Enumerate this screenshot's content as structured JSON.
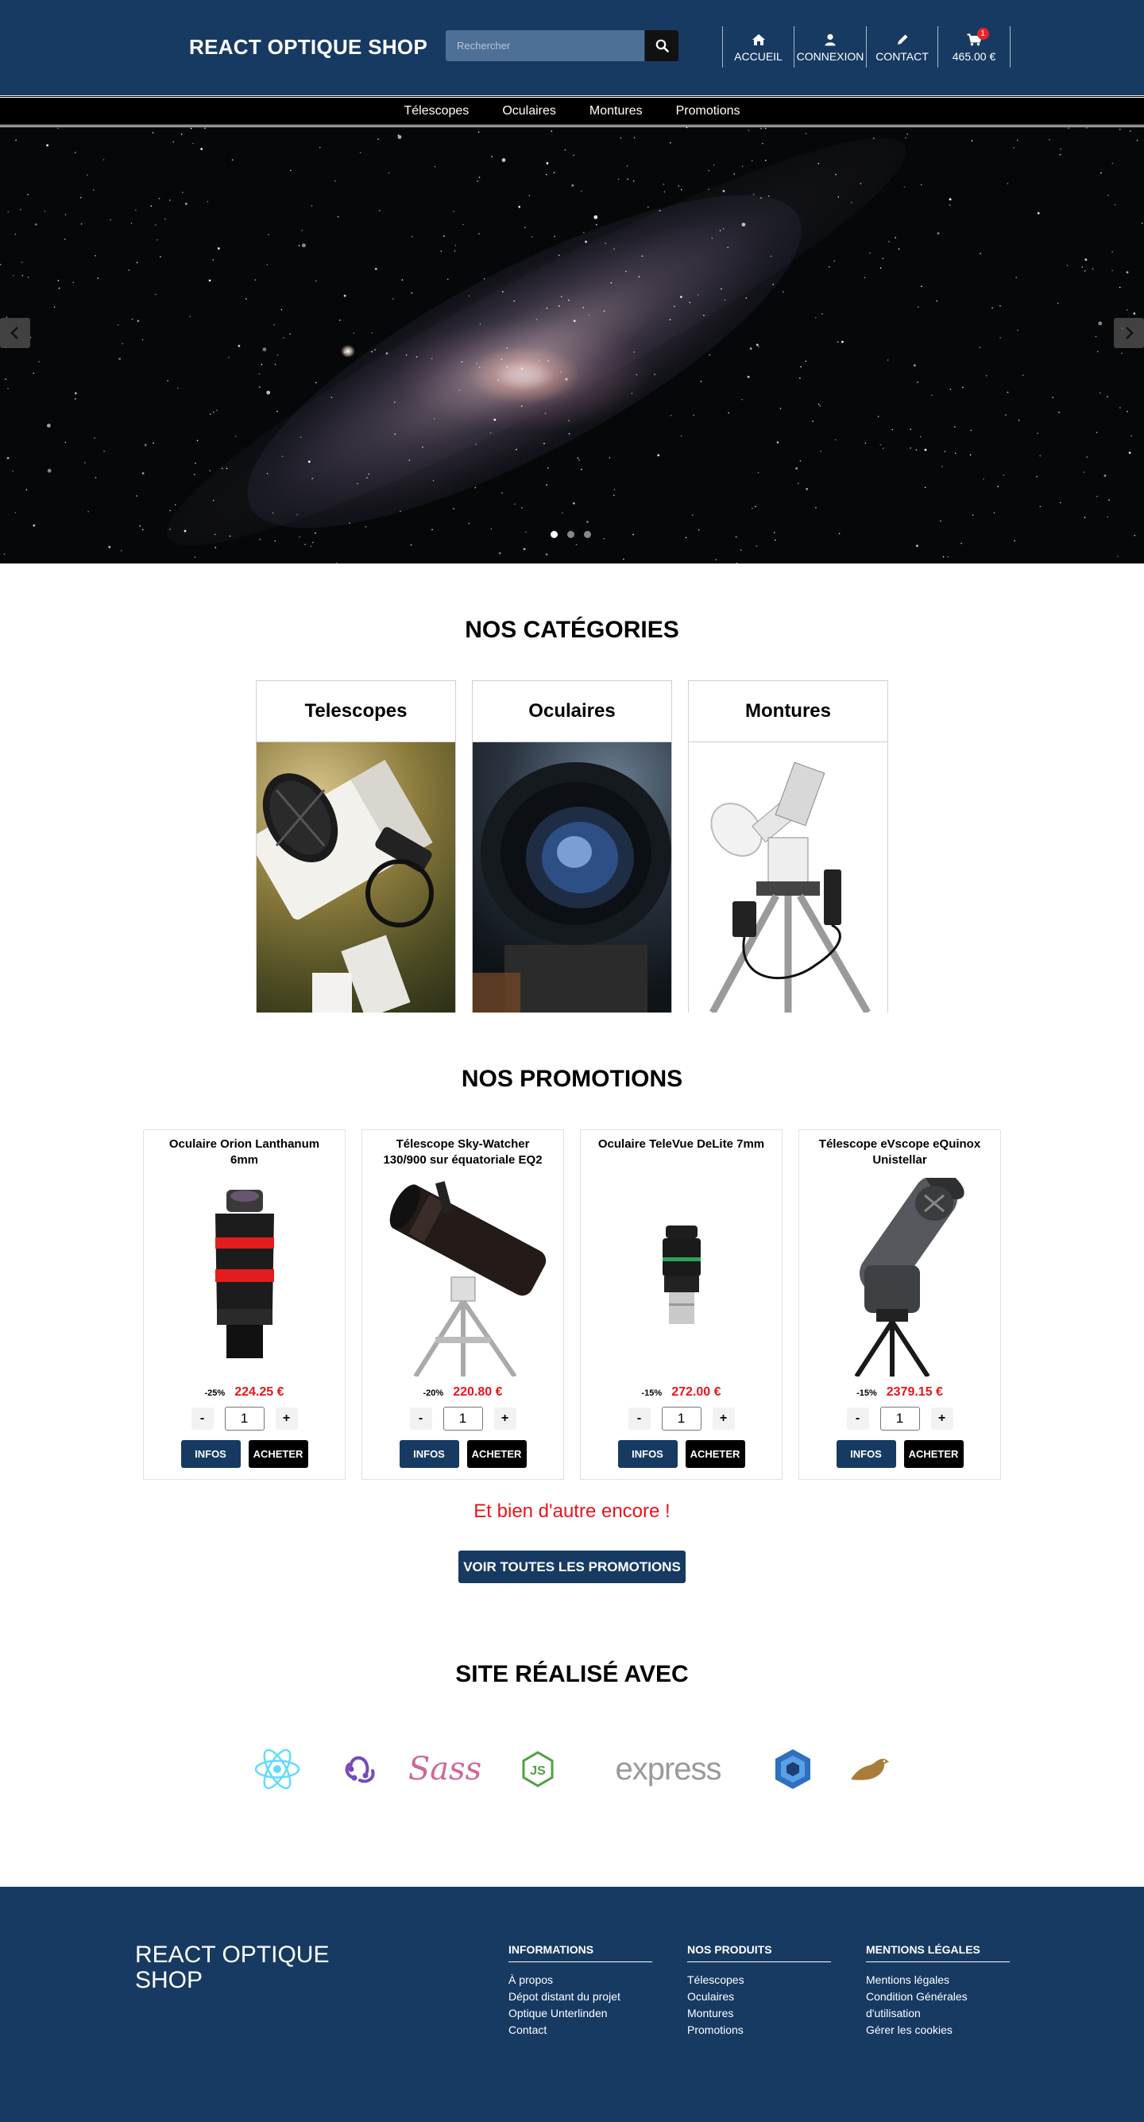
{
  "header": {
    "logo": "REACT OPTIQUE SHOP",
    "search_placeholder": "Rechercher",
    "nav": {
      "accueil": "ACCUEIL",
      "connexion": "CONNEXION",
      "contact": "CONTACT",
      "cart_total": "465.00 €",
      "cart_count": "1"
    }
  },
  "category_bar": [
    "Télescopes",
    "Oculaires",
    "Montures",
    "Promotions"
  ],
  "hero": {
    "slide_count": 3,
    "active_slide": 1
  },
  "categories": {
    "title": "NOS CATÉGORIES",
    "items": [
      "Telescopes",
      "Oculaires",
      "Montures"
    ]
  },
  "promotions": {
    "title": "NOS PROMOTIONS",
    "items": [
      {
        "name": "Oculaire Orion Lanthanum 6mm",
        "discount": "-25%",
        "price": "224.25 €",
        "qty": "1"
      },
      {
        "name": "Télescope Sky-Watcher 130/900 sur équatoriale EQ2",
        "discount": "-20%",
        "price": "220.80 €",
        "qty": "1"
      },
      {
        "name": "Oculaire TeleVue DeLite 7mm",
        "discount": "-15%",
        "price": "272.00 €",
        "qty": "1"
      },
      {
        "name": "Télescope eVscope eQuinox Unistellar",
        "discount": "-15%",
        "price": "2379.15 €",
        "qty": "1"
      }
    ],
    "minus": "-",
    "plus": "+",
    "infos_label": "INFOS",
    "buy_label": "ACHETER",
    "more_text": "Et bien d'autre encore !",
    "see_all": "VOIR TOUTES LES PROMOTIONS"
  },
  "tech": {
    "title": "SITE RÉALISÉ AVEC",
    "logos": [
      "react-icon",
      "redux-icon",
      "sass-icon",
      "nodejs-icon",
      "express-icon",
      "sequelize-icon",
      "mariadb-icon"
    ],
    "sass_text": "Sass",
    "express_text": "express",
    "colors": {
      "react": "#61dafb",
      "redux": "#764abc",
      "sass": "#cd6799",
      "node": "#539e43",
      "express": "#9a9a9a",
      "sequelize": "#2f6fbf",
      "mariadb": "#a87d3a"
    }
  },
  "footer": {
    "logo": "REACT OPTIQUE SHOP",
    "columns": [
      {
        "title": "INFORMATIONS",
        "links": [
          "À propos",
          "Dépot distant du projet",
          "Optique Unterlinden",
          "Contact"
        ]
      },
      {
        "title": "NOS PRODUITS",
        "links": [
          "Télescopes",
          "Oculaires",
          "Montures",
          "Promotions"
        ]
      },
      {
        "title": "MENTIONS LÉGALES",
        "links": [
          "Mentions légales",
          "Condition Générales",
          "d'utilisation",
          "Gérer les cookies"
        ]
      }
    ]
  },
  "colors": {
    "primary": "#173a63",
    "accent_red": "#e8141c",
    "black": "#000000"
  }
}
